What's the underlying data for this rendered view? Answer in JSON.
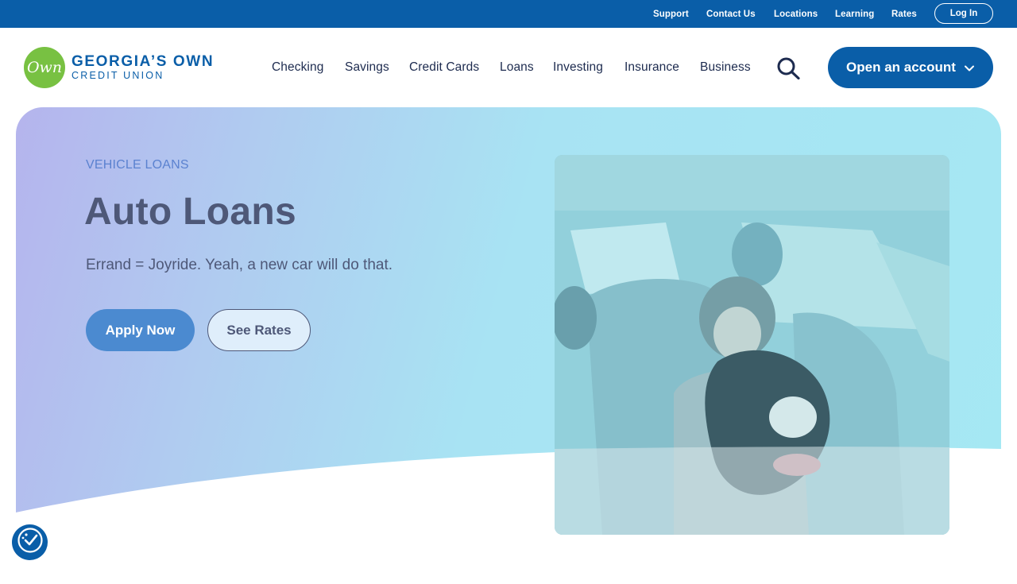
{
  "utility_nav": {
    "links": [
      "Support",
      "Contact Us",
      "Locations",
      "Learning",
      "Rates"
    ],
    "login_label": "Log In"
  },
  "brand": {
    "logo_mark": "Own",
    "name_line1": "GEORGIA’S OWN",
    "name_line2": "CREDIT UNION"
  },
  "main_nav": {
    "items": [
      "Checking",
      "Savings",
      "Credit Cards",
      "Loans",
      "Investing",
      "Insurance",
      "Business"
    ],
    "search_icon": "search-icon",
    "open_account_label": "Open an account"
  },
  "hero": {
    "eyebrow": "VEHICLE LOANS",
    "title": "Auto Loans",
    "subtitle": "Errand = Joyride. Yeah, a new car will do that.",
    "primary_cta": "Apply Now",
    "secondary_cta": "See Rates",
    "image": "girl-and-dog-in-car-photo"
  },
  "accessibility": {
    "icon": "accessibility-icon"
  },
  "colors": {
    "brand_blue": "#0a5ea8",
    "brand_green": "#78c142",
    "text_dark": "#1d2b4f",
    "hero_text": "#4e5878",
    "eyebrow": "#5b82d0",
    "apply_button": "#4b8ad0"
  }
}
